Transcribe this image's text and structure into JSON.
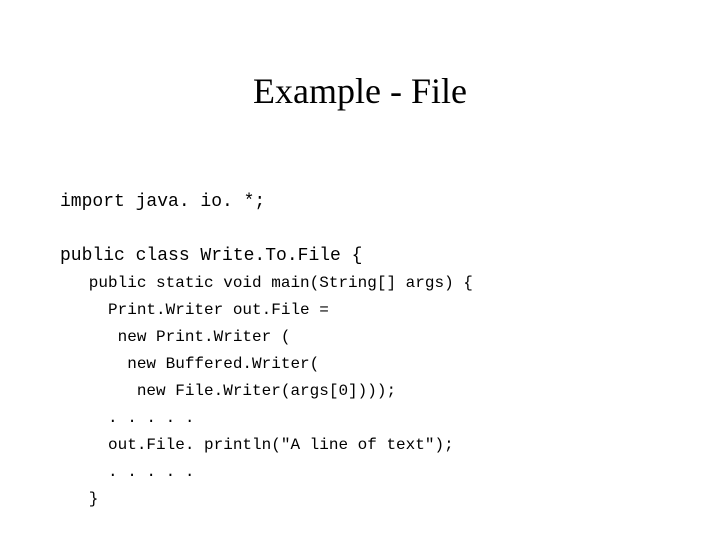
{
  "title": "Example - File",
  "code": {
    "line1": "import java. io. *;",
    "line2": "",
    "line3": "public class Write.To.File {",
    "line4": "   public static void main(String[] args) {",
    "line5": "     Print.Writer out.File =",
    "line6": "      new Print.Writer (",
    "line7": "       new Buffered.Writer(",
    "line8": "        new File.Writer(args[0])));",
    "line9": "     . . . . .",
    "line10": "     out.File. println(\"A line of text\");",
    "line11": "     . . . . .",
    "line12": "   }"
  }
}
